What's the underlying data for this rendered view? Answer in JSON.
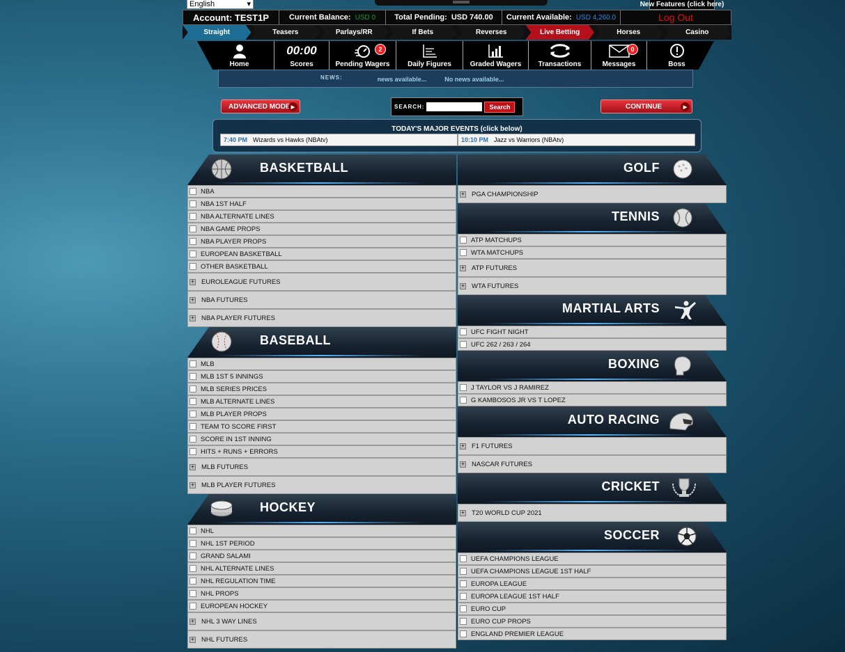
{
  "language": "English",
  "new_features": "New Features (click here)",
  "account": {
    "label": "Account: TEST1P",
    "balance_label": "Current Balance:",
    "balance_value": "USD 0",
    "pending_label": "Total Pending:",
    "pending_value": "USD 740.00",
    "available_label": "Current Available:",
    "available_value": "USD 4,260.0",
    "logout": "Log Out"
  },
  "bet_tabs": [
    "Straight",
    "Teasers",
    "Parlays/RR",
    "If Bets",
    "Reverses",
    "Live Betting",
    "Horses",
    "Casino"
  ],
  "nav": [
    {
      "label": "Home",
      "icon": "person-icon"
    },
    {
      "label": "Scores",
      "icon": "scoreboard-icon",
      "glyph": "00:00"
    },
    {
      "label": "Pending Wagers",
      "icon": "stopwatch-icon",
      "badge": "2"
    },
    {
      "label": "Daily Figures",
      "icon": "chart-icon"
    },
    {
      "label": "Graded Wagers",
      "icon": "bar-chart-icon"
    },
    {
      "label": "Transactions",
      "icon": "exchange-icon"
    },
    {
      "label": "Messages",
      "icon": "envelope-icon",
      "badge": "0"
    },
    {
      "label": "Boss",
      "icon": "alert-icon"
    }
  ],
  "news": {
    "label": "NEWS:",
    "text1": "news available...",
    "text2": "No news available..."
  },
  "advanced_mode": "ADVANCED MODE",
  "continue": "CONTINUE",
  "search": {
    "label": "SEARCH:",
    "button": "Search"
  },
  "majors": {
    "title": "TODAY'S MAJOR EVENTS (click below)",
    "events": [
      {
        "time": "7:40 PM",
        "name": "Wizards vs Hawks (NBAtv)"
      },
      {
        "time": "10:10 PM",
        "name": "Jazz vs Warriors (NBAtv)"
      }
    ]
  },
  "sections": {
    "basketball": {
      "title": "BASKETBALL",
      "items": [
        "NBA",
        "NBA 1ST HALF",
        "NBA ALTERNATE LINES",
        "NBA GAME PROPS",
        "NBA PLAYER PROPS",
        "EUROPEAN BASKETBALL",
        "OTHER BASKETBALL",
        "EUROLEAGUE FUTURES",
        "NBA FUTURES",
        "NBA PLAYER FUTURES"
      ]
    },
    "baseball": {
      "title": "BASEBALL",
      "items": [
        "MLB",
        "MLB 1ST 5 INNINGS",
        "MLB SERIES PRICES",
        "MLB ALTERNATE LINES",
        "MLB PLAYER PROPS",
        "TEAM TO SCORE FIRST",
        "SCORE IN 1ST INNING",
        "HITS + RUNS + ERRORS",
        "MLB FUTURES",
        "MLB PLAYER FUTURES"
      ]
    },
    "hockey": {
      "title": "HOCKEY",
      "items": [
        "NHL",
        "NHL 1ST PERIOD",
        "GRAND SALAMI",
        "NHL ALTERNATE LINES",
        "NHL REGULATION TIME",
        "NHL PROPS",
        "EUROPEAN HOCKEY",
        "NHL 3 WAY LINES",
        "NHL FUTURES"
      ]
    },
    "golf": {
      "title": "GOLF",
      "items": [
        "PGA CHAMPIONSHIP"
      ]
    },
    "tennis": {
      "title": "TENNIS",
      "items": [
        "ATP MATCHUPS",
        "WTA MATCHUPS",
        "ATP FUTURES",
        "WTA FUTURES"
      ]
    },
    "martial": {
      "title": "MARTIAL ARTS",
      "items": [
        "UFC FIGHT NIGHT",
        "UFC 262 / 263 / 264"
      ]
    },
    "boxing": {
      "title": "BOXING",
      "items": [
        "J TAYLOR VS J RAMIREZ",
        "G KAMBOSOS JR VS T LOPEZ"
      ]
    },
    "auto": {
      "title": "AUTO RACING",
      "items": [
        "F1 FUTURES",
        "NASCAR FUTURES"
      ]
    },
    "cricket": {
      "title": "CRICKET",
      "items": [
        "T20 WORLD CUP 2021"
      ]
    },
    "soccer": {
      "title": "SOCCER",
      "items": [
        "UEFA CHAMPIONS LEAGUE",
        "UEFA CHAMPIONS LEAGUE 1ST HALF",
        "EUROPA LEAGUE",
        "EUROPA LEAGUE 1ST HALF",
        "EURO CUP",
        "EURO CUP PROPS",
        "ENGLAND PREMIER LEAGUE"
      ]
    }
  }
}
